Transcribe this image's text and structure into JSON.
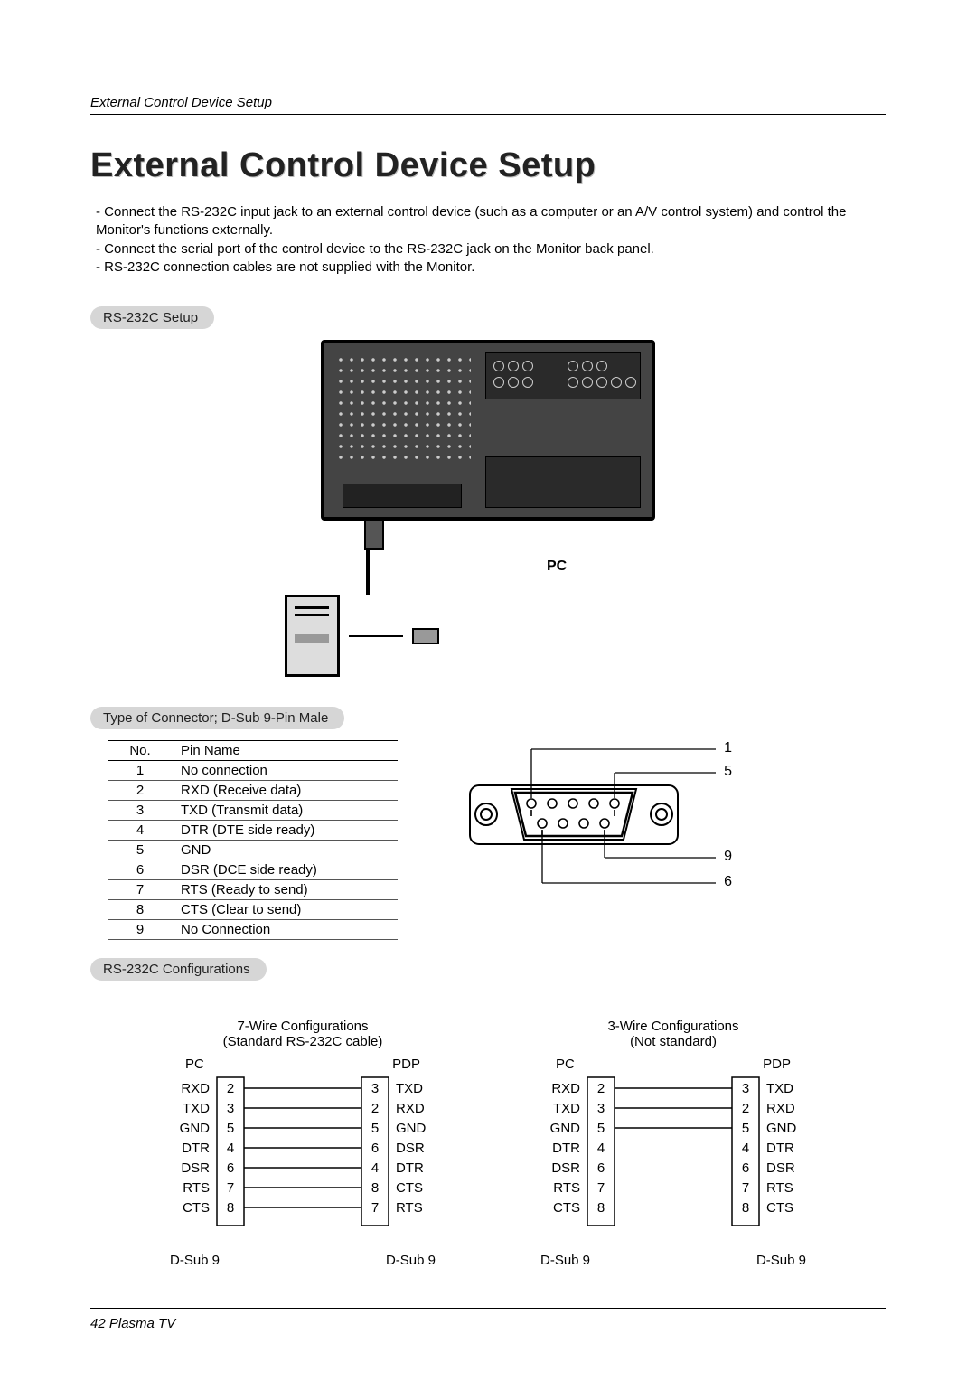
{
  "running_head": "External Control Device Setup",
  "title": "External Control Device Setup",
  "bullets": [
    "Connect the RS-232C input jack to an external control device (such as a computer or an A/V control system) and control the Monitor's functions externally.",
    "Connect the serial port of the control device to the RS-232C jack on the Monitor back panel.",
    "RS-232C connection cables are not supplied with the Monitor."
  ],
  "pill_setup": "RS-232C Setup",
  "diag": {
    "pc_label": "PC"
  },
  "pill_connector": "Type of Connector; D-Sub 9-Pin Male",
  "pin_table": {
    "headers": [
      "No.",
      "Pin Name"
    ],
    "rows": [
      [
        "1",
        "No connection"
      ],
      [
        "2",
        "RXD (Receive data)"
      ],
      [
        "3",
        "TXD (Transmit data)"
      ],
      [
        "4",
        "DTR (DTE side ready)"
      ],
      [
        "5",
        "GND"
      ],
      [
        "6",
        "DSR (DCE side ready)"
      ],
      [
        "7",
        "RTS (Ready to send)"
      ],
      [
        "8",
        "CTS (Clear to send)"
      ],
      [
        "9",
        "No Connection"
      ]
    ]
  },
  "db9_labels": {
    "p1": "1",
    "p5": "5",
    "p9": "9",
    "p6": "6"
  },
  "pill_config": "RS-232C Configurations",
  "wiring": {
    "left": {
      "title1": "7-Wire Configurations",
      "title2": "(Standard RS-232C cable)",
      "hdr_left": "PC",
      "hdr_right": "PDP",
      "dsub": "D-Sub 9",
      "rows": [
        {
          "l_name": "RXD",
          "l_pin": "2",
          "r_pin": "3",
          "r_name": "TXD"
        },
        {
          "l_name": "TXD",
          "l_pin": "3",
          "r_pin": "2",
          "r_name": "RXD"
        },
        {
          "l_name": "GND",
          "l_pin": "5",
          "r_pin": "5",
          "r_name": "GND"
        },
        {
          "l_name": "DTR",
          "l_pin": "4",
          "r_pin": "6",
          "r_name": "DSR"
        },
        {
          "l_name": "DSR",
          "l_pin": "6",
          "r_pin": "4",
          "r_name": "DTR"
        },
        {
          "l_name": "RTS",
          "l_pin": "7",
          "r_pin": "8",
          "r_name": "CTS"
        },
        {
          "l_name": "CTS",
          "l_pin": "8",
          "r_pin": "7",
          "r_name": "RTS"
        }
      ]
    },
    "right": {
      "title1": "3-Wire Configurations",
      "title2": "(Not standard)",
      "hdr_left": "PC",
      "hdr_right": "PDP",
      "dsub": "D-Sub 9",
      "rows": [
        {
          "l_name": "RXD",
          "l_pin": "2",
          "r_pin": "3",
          "r_name": "TXD",
          "conn": 1
        },
        {
          "l_name": "TXD",
          "l_pin": "3",
          "r_pin": "2",
          "r_name": "RXD",
          "conn": 1
        },
        {
          "l_name": "GND",
          "l_pin": "5",
          "r_pin": "5",
          "r_name": "GND",
          "conn": 1
        },
        {
          "l_name": "DTR",
          "l_pin": "4",
          "r_pin": "4",
          "r_name": "DTR",
          "conn": 0
        },
        {
          "l_name": "DSR",
          "l_pin": "6",
          "r_pin": "6",
          "r_name": "DSR",
          "conn": 0
        },
        {
          "l_name": "RTS",
          "l_pin": "7",
          "r_pin": "7",
          "r_name": "RTS",
          "conn": 0
        },
        {
          "l_name": "CTS",
          "l_pin": "8",
          "r_pin": "8",
          "r_name": "CTS",
          "conn": 0
        }
      ]
    }
  },
  "footer": "42  Plasma TV"
}
